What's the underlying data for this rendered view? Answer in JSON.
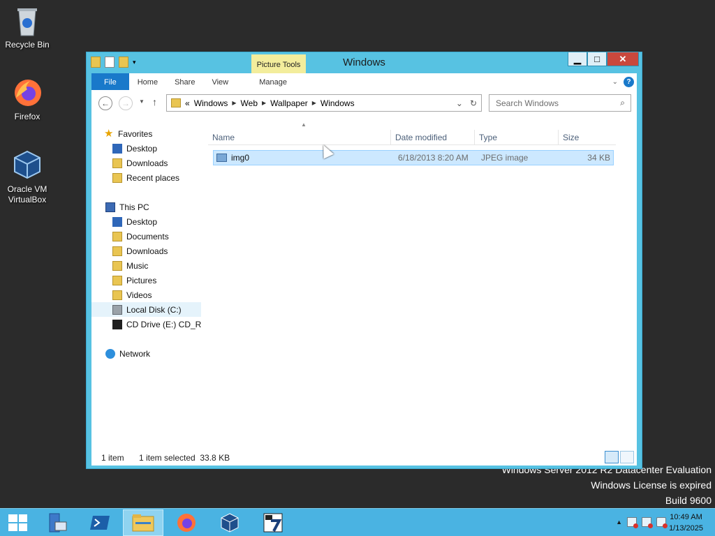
{
  "desktop": {
    "icons": [
      {
        "label": "Recycle Bin",
        "icon": "recycle-bin-icon"
      },
      {
        "label": "Firefox",
        "icon": "firefox-icon"
      },
      {
        "label": "Oracle VM VirtualBox",
        "icon": "virtualbox-icon"
      }
    ],
    "watermark": {
      "line1": "Windows Server 2012 R2 Datacenter Evaluation",
      "line2": "Windows License is expired",
      "line3": "Build 9600"
    }
  },
  "window": {
    "title": "Windows",
    "context_tab_group": "Picture Tools",
    "tabs": {
      "file": "File",
      "home": "Home",
      "share": "Share",
      "view": "View",
      "manage": "Manage"
    },
    "window_buttons": {
      "minimize": "▁",
      "maximize": "□",
      "close": "✕"
    },
    "help_label": "?",
    "address": {
      "overflow": "«",
      "segments": [
        "Windows",
        "Web",
        "Wallpaper",
        "Windows"
      ],
      "separator": "▶",
      "dropdown": "⌄",
      "refresh": "↻"
    },
    "search": {
      "placeholder": "Search Windows",
      "icon": "⌕"
    },
    "nav": {
      "favorites": {
        "label": "Favorites",
        "items": [
          "Desktop",
          "Downloads",
          "Recent places"
        ]
      },
      "this_pc": {
        "label": "This PC",
        "items": [
          "Desktop",
          "Documents",
          "Downloads",
          "Music",
          "Pictures",
          "Videos",
          "Local Disk (C:)",
          "CD Drive (E:) CD_RO"
        ]
      },
      "network": {
        "label": "Network"
      }
    },
    "columns": {
      "name": "Name",
      "date": "Date modified",
      "type": "Type",
      "size": "Size"
    },
    "files": [
      {
        "name": "img0",
        "date": "6/18/2013 8:20 AM",
        "type": "JPEG image",
        "size": "34 KB"
      }
    ],
    "status": {
      "count": "1 item",
      "selected": "1 item selected  33.8 KB"
    }
  },
  "taskbar": {
    "buttons": [
      {
        "name": "server-manager",
        "icon": "server-manager-icon"
      },
      {
        "name": "powershell",
        "icon": "powershell-icon"
      },
      {
        "name": "file-explorer",
        "icon": "file-explorer-icon",
        "active": true
      },
      {
        "name": "firefox",
        "icon": "firefox-icon"
      },
      {
        "name": "virtualbox",
        "icon": "virtualbox-icon"
      },
      {
        "name": "7zip",
        "icon": "7zip-icon"
      }
    ],
    "tray_arrow": "▲",
    "time": "10:49 AM",
    "date": "1/13/2025"
  }
}
